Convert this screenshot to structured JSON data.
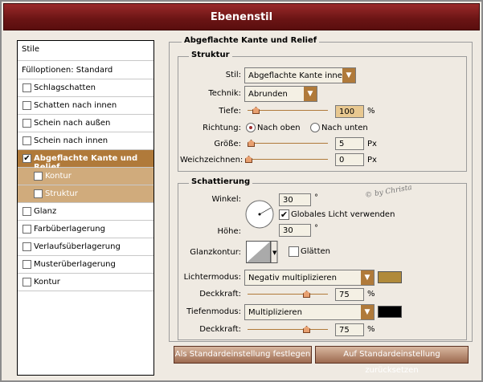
{
  "window": {
    "title": "Ebenenstil"
  },
  "sidebar": {
    "items": [
      {
        "label": "Stile",
        "kind": "plain"
      },
      {
        "label": "Fülloptionen: Standard",
        "kind": "plain"
      },
      {
        "label": "Schlagschatten",
        "checked": false
      },
      {
        "label": "Schatten nach innen",
        "checked": false
      },
      {
        "label": "Schein nach außen",
        "checked": false
      },
      {
        "label": "Schein nach innen",
        "checked": false
      },
      {
        "label": "Abgeflachte Kante und Relief",
        "checked": true,
        "selected": true
      },
      {
        "label": "Kontur",
        "checked": false,
        "sub": true
      },
      {
        "label": "Struktur",
        "checked": false,
        "sub": true
      },
      {
        "label": "Glanz",
        "checked": false
      },
      {
        "label": "Farbüberlagerung",
        "checked": false
      },
      {
        "label": "Verlaufsüberlagerung",
        "checked": false
      },
      {
        "label": "Musterüberlagerung",
        "checked": false
      },
      {
        "label": "Kontur",
        "checked": false
      }
    ]
  },
  "panel": {
    "title": "Abgeflachte Kante und Relief",
    "struktur": {
      "title": "Struktur",
      "stil_label": "Stil:",
      "stil_value": "Abgeflachte Kante innen",
      "technik_label": "Technik:",
      "technik_value": "Abrunden",
      "tiefe_label": "Tiefe:",
      "tiefe_value": "100",
      "tiefe_unit": "%",
      "richtung_label": "Richtung:",
      "richtung_up": "Nach oben",
      "richtung_down": "Nach unten",
      "groesse_label": "Größe:",
      "groesse_value": "5",
      "groesse_unit": "Px",
      "weich_label": "Weichzeichnen:",
      "weich_value": "0",
      "weich_unit": "Px"
    },
    "schattierung": {
      "title": "Schattierung",
      "winkel_label": "Winkel:",
      "winkel_value": "30",
      "winkel_unit": "°",
      "global_label": "Globales Licht verwenden",
      "hoehe_label": "Höhe:",
      "hoehe_value": "30",
      "hoehe_unit": "°",
      "glanz_label": "Glanzkontur:",
      "glaetten_label": "Glätten",
      "lichter_label": "Lichtermodus:",
      "lichter_value": "Negativ multiplizieren",
      "lichter_color": "#b08a3a",
      "deck1_label": "Deckkraft:",
      "deck1_value": "75",
      "deck1_unit": "%",
      "tiefen_label": "Tiefenmodus:",
      "tiefen_value": "Multiplizieren",
      "tiefen_color": "#000000",
      "deck2_label": "Deckkraft:",
      "deck2_value": "75",
      "deck2_unit": "%"
    },
    "buttons": {
      "set_default": "Als Standardeinstellung festlegen",
      "reset_default": "Auf Standardeinstellung zurücksetzen"
    }
  },
  "watermark": "© by Christa"
}
